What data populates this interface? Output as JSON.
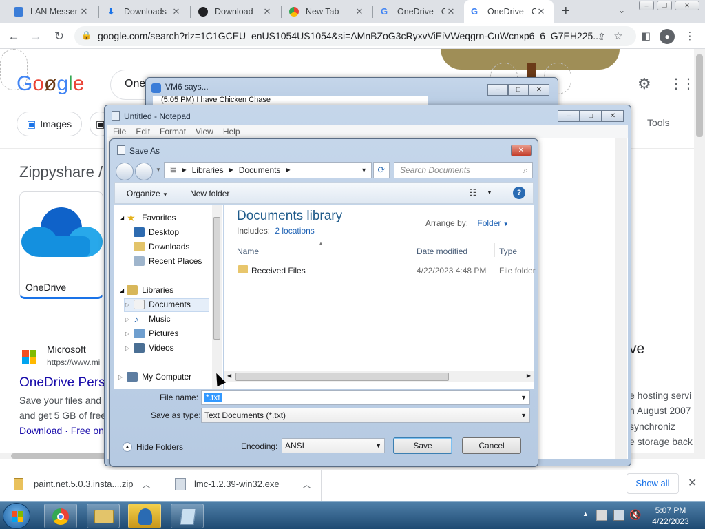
{
  "browser": {
    "tabs": [
      {
        "label": "LAN Messen",
        "active": false
      },
      {
        "label": "Downloads",
        "active": false
      },
      {
        "label": "Download",
        "active": false
      },
      {
        "label": "New Tab",
        "active": false
      },
      {
        "label": "OneDrive - C",
        "active": false
      },
      {
        "label": "OneDrive - C",
        "active": true
      }
    ],
    "url": "google.com/search?rlz=1C1GCEU_enUS1054US1054&si=AMnBZoG3cRyxvViEiVWeqgrn-CuWcnxp6_6_G7EH225..."
  },
  "google": {
    "logo": "Google",
    "search_value": "One",
    "filters": [
      "Images",
      "Tools"
    ],
    "heading": "Zippyshare /",
    "card_title": "OneDrive",
    "result_source": "Microsoft",
    "result_url": "https://www.mi",
    "result_title": "OneDrive Pers",
    "result_snippet_1": "Save your files and p",
    "result_snippet_2": "and get 5 GB of free",
    "result_links": "Download · Free onl",
    "right_frag_1": "ve",
    "right_frag_2": "e hosting servi",
    "right_frag_3": "n August 2007",
    "right_frag_4": "synchroniz",
    "right_frag_5": "e storage back"
  },
  "vm6": {
    "title": "VM6 says...",
    "message": "(5:05 PM) I have Chicken Chase"
  },
  "notepad": {
    "title": "Untitled - Notepad",
    "menu": [
      "File",
      "Edit",
      "Format",
      "View",
      "Help"
    ]
  },
  "saveas": {
    "title": "Save As",
    "breadcrumb": [
      "Libraries",
      "Documents"
    ],
    "search_placeholder": "Search Documents",
    "organize": "Organize",
    "new_folder": "New folder",
    "nav": {
      "favorites": "Favorites",
      "desktop": "Desktop",
      "downloads": "Downloads",
      "recent": "Recent Places",
      "libraries": "Libraries",
      "documents": "Documents",
      "music": "Music",
      "pictures": "Pictures",
      "videos": "Videos",
      "computer": "My Computer"
    },
    "library_title": "Documents library",
    "includes_label": "Includes:",
    "includes_link": "2 locations",
    "arrange_label": "Arrange by:",
    "arrange_value": "Folder",
    "columns": {
      "name": "Name",
      "date": "Date modified",
      "type": "Type"
    },
    "files": [
      {
        "name": "Received Files",
        "date": "4/22/2023 4:48 PM",
        "type": "File folder"
      }
    ],
    "filename_label": "File name:",
    "filename_value": "*.txt",
    "savetype_label": "Save as type:",
    "savetype_value": "Text Documents (*.txt)",
    "hide_folders": "Hide Folders",
    "encoding_label": "Encoding:",
    "encoding_value": "ANSI",
    "save": "Save",
    "cancel": "Cancel"
  },
  "downloads_bar": {
    "items": [
      "paint.net.5.0.3.insta....zip",
      "lmc-1.2.39-win32.exe"
    ],
    "show_all": "Show all"
  },
  "taskbar": {
    "time": "5:07 PM",
    "date": "4/22/2023"
  }
}
